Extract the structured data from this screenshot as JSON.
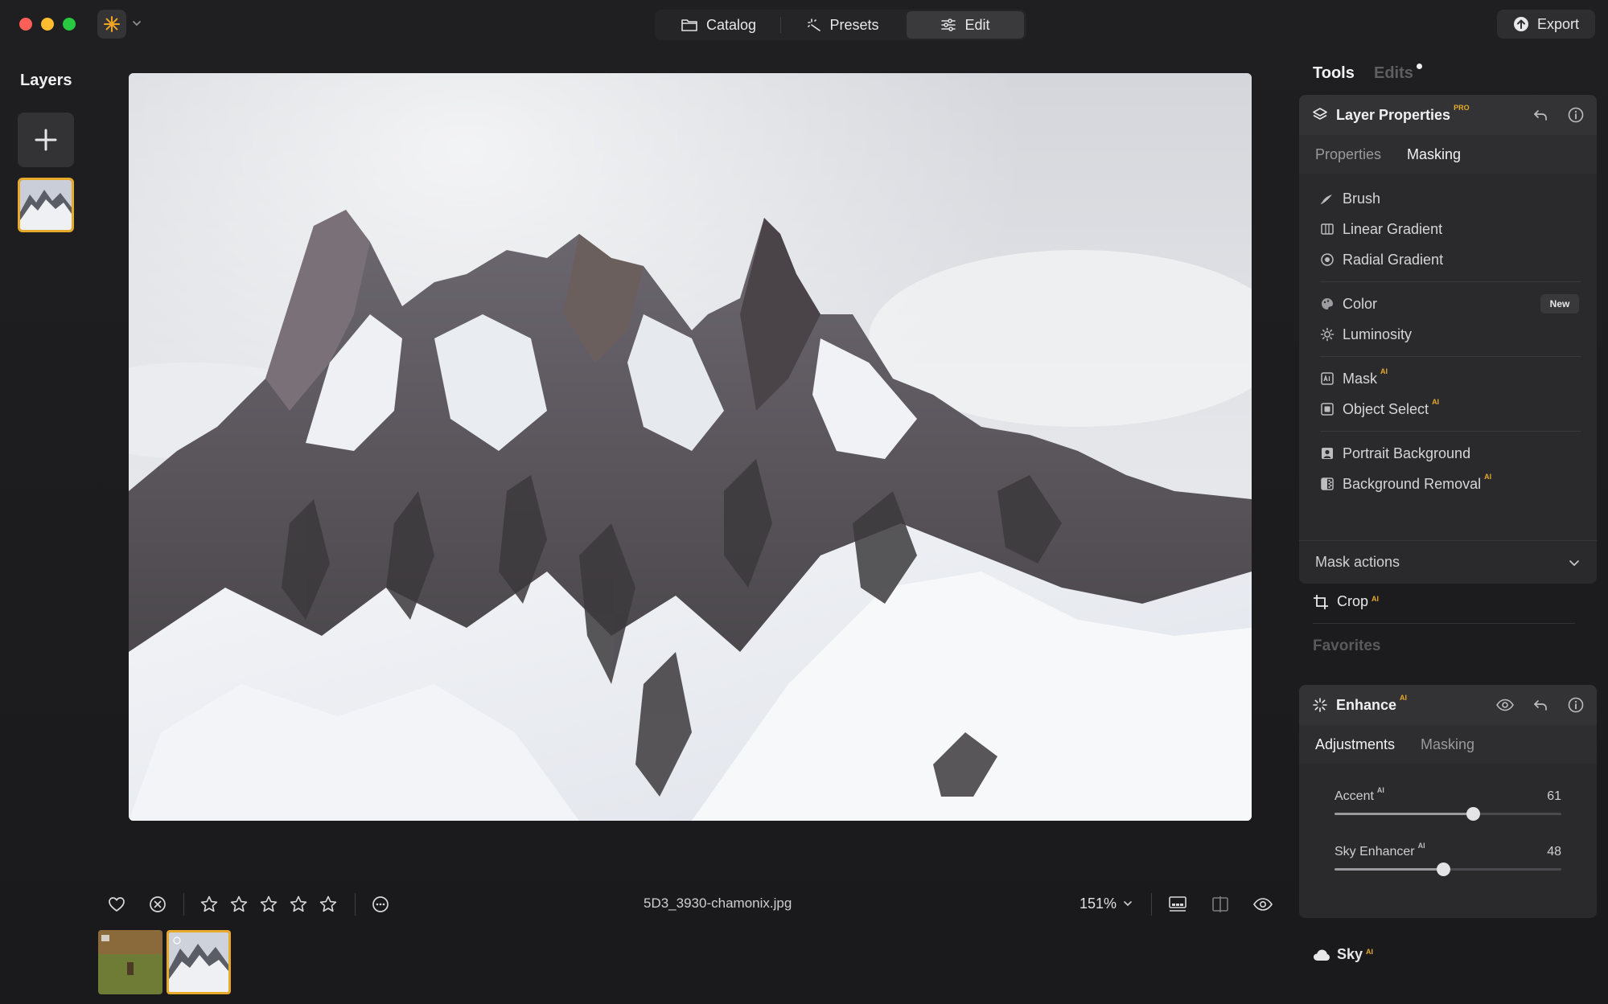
{
  "titlebar": {
    "nav": {
      "catalog": "Catalog",
      "presets": "Presets",
      "edit": "Edit"
    },
    "export_label": "Export"
  },
  "layers": {
    "title": "Layers"
  },
  "canvas": {
    "filename": "5D3_3930-chamonix.jpg",
    "zoom": "151%"
  },
  "right_panel": {
    "tabs": {
      "tools": "Tools",
      "edits": "Edits"
    },
    "layer_properties": {
      "title": "Layer Properties",
      "badge": "PRO",
      "subtabs": {
        "properties": "Properties",
        "masking": "Masking"
      },
      "items": {
        "brush": "Brush",
        "linear_gradient": "Linear Gradient",
        "radial_gradient": "Radial Gradient",
        "color": "Color",
        "color_badge": "New",
        "luminosity": "Luminosity",
        "mask": "Mask",
        "object_select": "Object Select",
        "portrait_background": "Portrait Background",
        "background_removal": "Background Removal"
      },
      "ai_badge": "AI",
      "mask_actions": "Mask actions"
    },
    "crop": {
      "label": "Crop",
      "badge": "AI"
    },
    "favorites": "Favorites",
    "enhance": {
      "title": "Enhance",
      "badge": "AI",
      "subtabs": {
        "adjustments": "Adjustments",
        "masking": "Masking"
      },
      "sliders": [
        {
          "label": "Accent",
          "badge": "AI",
          "value": 61,
          "fraction": 0.61
        },
        {
          "label": "Sky Enhancer",
          "badge": "AI",
          "value": 48,
          "fraction": 0.48
        }
      ]
    },
    "sky": {
      "label": "Sky",
      "badge": "AI"
    }
  },
  "colors": {
    "accent": "#e6a92a",
    "background": "#1b1b1d",
    "panel": "#2a2a2d"
  }
}
